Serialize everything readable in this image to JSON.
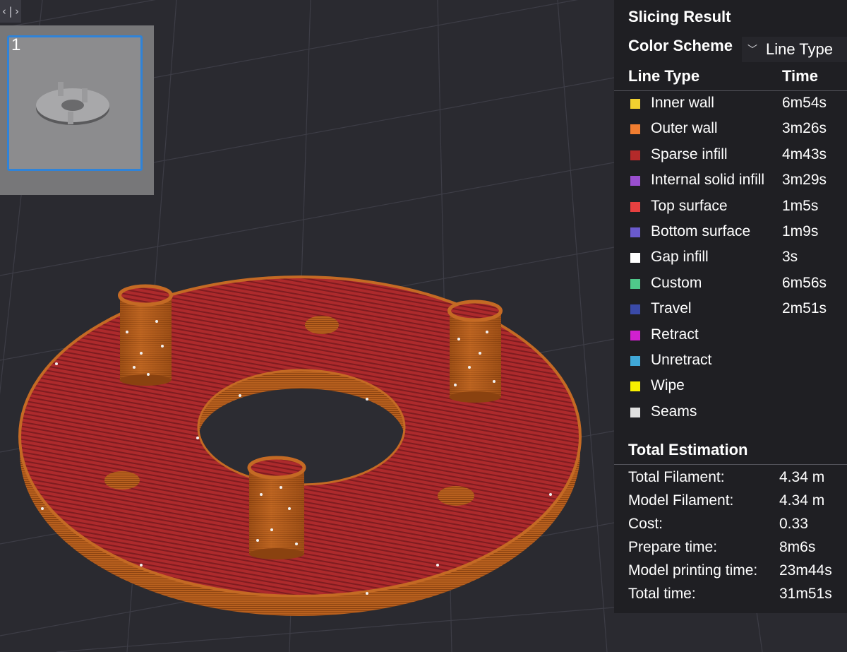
{
  "collapse_icon": "sidebar-collapse-icon",
  "plate": {
    "number": "1"
  },
  "panel": {
    "title": "Slicing Result",
    "color_scheme_label": "Color Scheme",
    "color_scheme_value": "Line Type",
    "col_line_type": "Line Type",
    "col_time": "Time",
    "line_types": [
      {
        "label": "Inner wall",
        "time": "6m54s",
        "color": "#f0d030"
      },
      {
        "label": "Outer wall",
        "time": "3m26s",
        "color": "#f07d30"
      },
      {
        "label": "Sparse infill",
        "time": "4m43s",
        "color": "#b42a2a"
      },
      {
        "label": "Internal solid infill",
        "time": "3m29s",
        "color": "#9a4fcf"
      },
      {
        "label": "Top surface",
        "time": "1m5s",
        "color": "#e64040"
      },
      {
        "label": "Bottom surface",
        "time": "1m9s",
        "color": "#6a5acd"
      },
      {
        "label": "Gap infill",
        "time": "3s",
        "color": "#ffffff"
      },
      {
        "label": "Custom",
        "time": "6m56s",
        "color": "#4fc88a"
      },
      {
        "label": "Travel",
        "time": "2m51s",
        "color": "#3a4aa8"
      },
      {
        "label": "Retract",
        "time": "",
        "color": "#d020d0"
      },
      {
        "label": "Unretract",
        "time": "",
        "color": "#40a8d8"
      },
      {
        "label": "Wipe",
        "time": "",
        "color": "#f8f000"
      },
      {
        "label": "Seams",
        "time": "",
        "color": "#e0e0e0"
      }
    ],
    "total_estimation_title": "Total Estimation",
    "estimates": [
      {
        "label": "Total Filament:",
        "value": "4.34 m"
      },
      {
        "label": "Model Filament:",
        "value": "4.34 m"
      },
      {
        "label": "Cost:",
        "value": "0.33"
      },
      {
        "label": "Prepare time:",
        "value": "8m6s"
      },
      {
        "label": "Model printing time:",
        "value": "23m44s"
      },
      {
        "label": "Total time:",
        "value": "31m51s"
      }
    ]
  },
  "colors": {
    "background": "#2a2a30",
    "grid": "#3a3a42",
    "top_surface": "#a8262a",
    "wall": "#b55a1a",
    "selection": "#2f83d8"
  }
}
